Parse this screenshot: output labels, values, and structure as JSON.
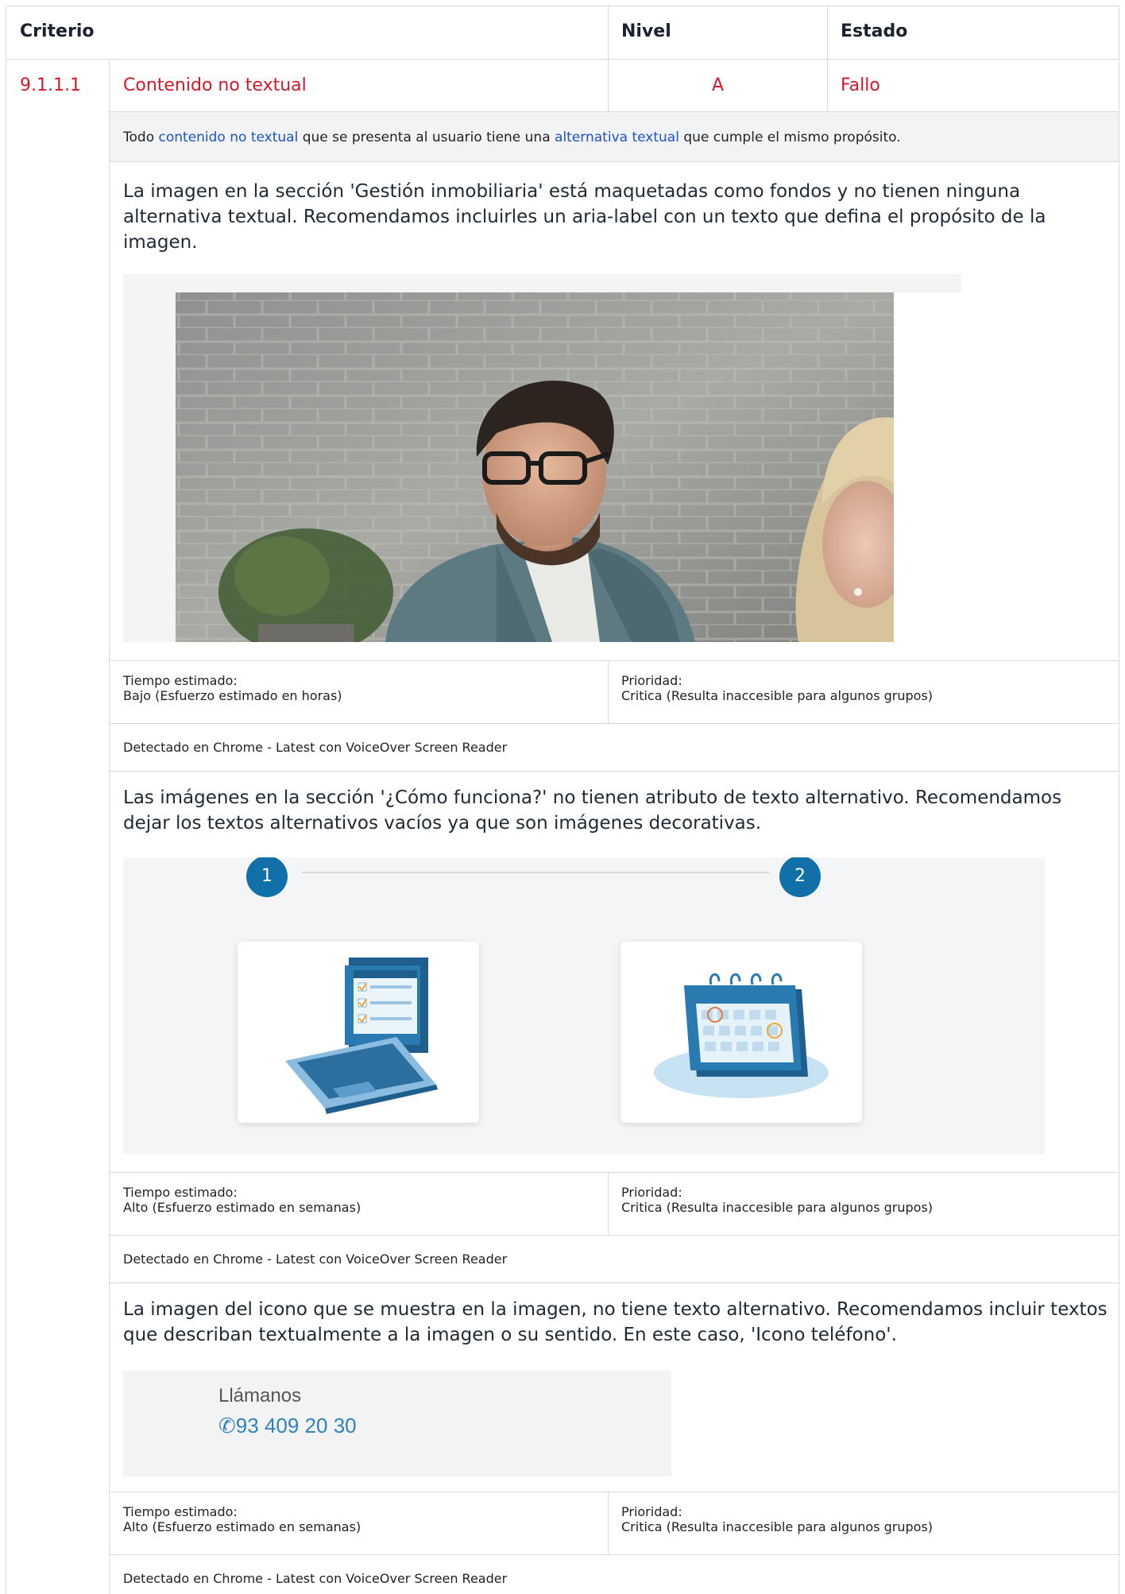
{
  "header": {
    "criterio": "Criterio",
    "nivel": "Nivel",
    "estado": "Estado"
  },
  "row": {
    "id": "9.1.1.1",
    "name": "Contenido no textual",
    "level": "A",
    "status": "Fallo"
  },
  "definition": {
    "prefix": "Todo ",
    "link1": "contenido no textual",
    "middle": " que se presenta al usuario tiene una ",
    "link2": "alternativa textual",
    "suffix": " que cumple el mismo propósito."
  },
  "issues": [
    {
      "description": "La imagen en la sección 'Gestión inmobiliaria' está maquetadas como fondos y no tienen ninguna alternativa textual. Recomendamos incluirles un aria-label con un texto que defina el propósito de la imagen.",
      "tiempo_label": "Tiempo estimado:",
      "tiempo_value": "Bajo (Esfuerzo estimado en horas)",
      "prioridad_label": "Prioridad:",
      "prioridad_value": "Critica (Resulta inaccesible para algunos grupos)",
      "detected": "Detectado en Chrome - Latest con VoiceOver Screen Reader"
    },
    {
      "description": "Las imágenes en la sección '¿Cómo funciona?' no tienen atributo de texto alternativo. Recomendamos dejar los textos alternativos vacíos ya que son imágenes decorativas.",
      "steps": [
        "1",
        "2"
      ],
      "tiempo_label": "Tiempo estimado:",
      "tiempo_value": "Alto (Esfuerzo estimado en semanas)",
      "prioridad_label": "Prioridad:",
      "prioridad_value": "Critica (Resulta inaccesible para algunos grupos)",
      "detected": "Detectado en Chrome - Latest con VoiceOver Screen Reader"
    },
    {
      "description": "La imagen del icono que se muestra en la imagen, no tiene texto alternativo. Recomendamos incluir textos que describan textualmente a la imagen o su sentido. En este caso, 'Icono teléfono'.",
      "call_label": "Llámanos",
      "phone": "93 409 20 30",
      "tiempo_label": "Tiempo estimado:",
      "tiempo_value": "Alto (Esfuerzo estimado en semanas)",
      "prioridad_label": "Prioridad:",
      "prioridad_value": "Critica (Resulta inaccesible para algunos grupos)",
      "detected": "Detectado en Chrome - Latest con VoiceOver Screen Reader"
    }
  ],
  "colors": {
    "accent_red": "#d4182a",
    "link_blue": "#1f52c8",
    "step_blue": "#1270a8",
    "border": "#d9d9d9"
  }
}
